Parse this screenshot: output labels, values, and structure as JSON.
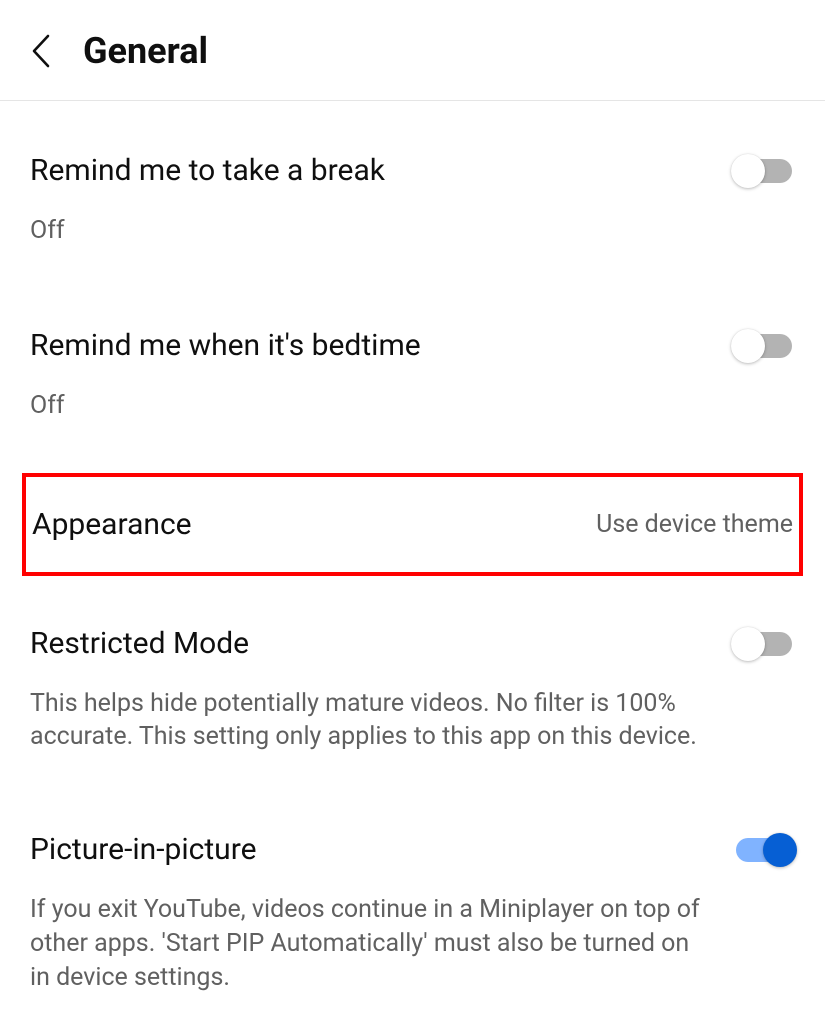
{
  "header": {
    "title": "General"
  },
  "settings": {
    "break": {
      "title": "Remind me to take a break",
      "status": "Off",
      "toggled": false
    },
    "bedtime": {
      "title": "Remind me when it's bedtime",
      "status": "Off",
      "toggled": false
    },
    "appearance": {
      "title": "Appearance",
      "value": "Use device theme"
    },
    "restricted": {
      "title": "Restricted Mode",
      "description": "This helps hide potentially mature videos. No filter is 100% accurate. This setting only applies to this app on this device.",
      "toggled": false
    },
    "pip": {
      "title": "Picture-in-picture",
      "description": "If you exit YouTube, videos continue in a Miniplayer on top of other apps. 'Start PIP Automatically' must also be turned on in device settings.",
      "toggled": true
    }
  }
}
